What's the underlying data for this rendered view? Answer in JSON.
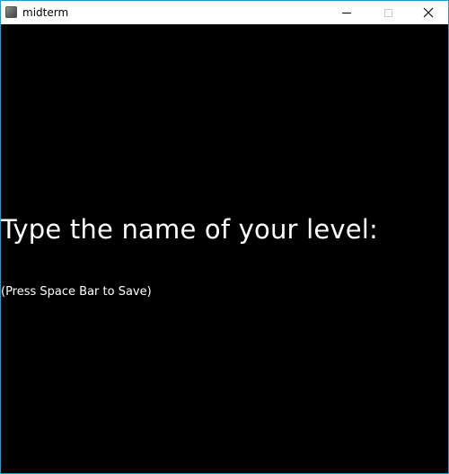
{
  "window": {
    "title": "midterm",
    "app_icon": "app-icon",
    "controls": {
      "minimize_icon": "minimize-icon",
      "maximize_icon": "maximize-icon",
      "close_icon": "close-icon"
    }
  },
  "canvas": {
    "background": "#000000",
    "prompt": "Type the name of your level:",
    "hint": "(Press Space Bar to Save)"
  },
  "colors": {
    "titlebar": "#ffffff",
    "window_border": "#1e9ad6",
    "text": "#ffffff"
  }
}
